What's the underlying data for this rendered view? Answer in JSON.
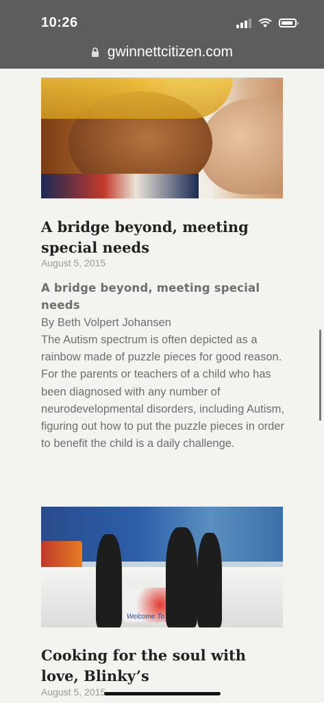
{
  "status_bar": {
    "time": "10:26",
    "url": "gwinnettcitizen.com"
  },
  "articles": [
    {
      "title": "A bridge beyond, meeting special needs",
      "date": "August 5, 2015",
      "subheading": "A bridge beyond, meeting special needs",
      "byline": "By Beth Volpert Johansen",
      "excerpt": "The Autism spectrum is often depicted as a rainbow made of puzzle pieces for good reason. For the parents or teachers of a child who has been diagnosed with any number of neurodevelopmental disorders, including Autism, figuring out how to put the puzzle pieces in order to benefit the child is a daily challenge."
    },
    {
      "title": "Cooking for the soul with love, Blinky’s",
      "date": "August 5, 2015",
      "image_sign": "Welcome To B"
    }
  ]
}
